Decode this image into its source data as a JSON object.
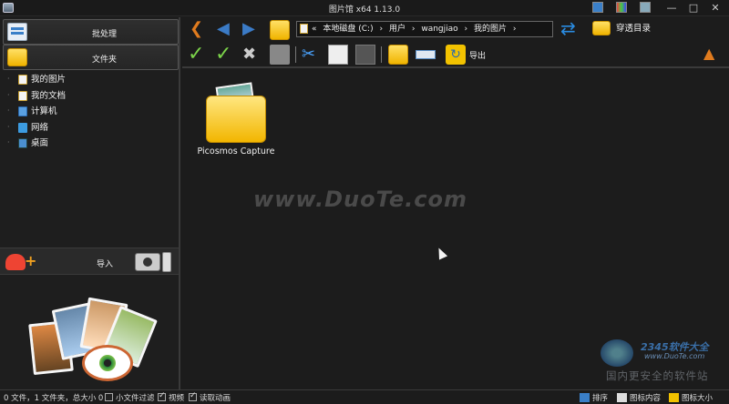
{
  "window": {
    "title": "图片馆 x64 1.13.0",
    "controls": [
      "—",
      "□",
      "✕"
    ]
  },
  "left_panel": {
    "batch_label": "批处理",
    "folder_label": "文件夹",
    "tree": [
      {
        "label": "我的图片",
        "icon": "pictures-icon"
      },
      {
        "label": "我的文档",
        "icon": "documents-icon"
      },
      {
        "label": "计算机",
        "icon": "computer-icon"
      },
      {
        "label": "网络",
        "icon": "network-icon"
      },
      {
        "label": "桌面",
        "icon": "desktop-icon"
      }
    ],
    "import_label": "导入"
  },
  "toolbar": {
    "path": [
      "«",
      "本地磁盘 (C:)",
      "›",
      "用户",
      "›",
      "wangjiao",
      "›",
      "我的图片",
      "›"
    ],
    "see_through_label": "穿透目录",
    "export_label": "导出"
  },
  "content": {
    "folders": [
      {
        "name": "Picosmos Capture"
      }
    ],
    "watermark": "www.DuoTe.com",
    "corner_watermark": {
      "line1": "2345软件大全",
      "line2": "www.DuoTe.com",
      "line3": "国内更安全的软件站"
    }
  },
  "status": {
    "summary": "0 文件，1 文件夹，总大小 0",
    "small_file_filter_label": "小文件过滤",
    "small_file_filter_checked": false,
    "preview_label": "视频",
    "preview_checked": true,
    "animation_label": "读取动画",
    "animation_checked": true,
    "sort_label": "排序",
    "icon_content_label": "图标内容",
    "icon_size_label": "图标大小"
  },
  "colors": {
    "background": "#1c1c1c",
    "accent_orange": "#e07b1e",
    "accent_blue": "#2a8be0",
    "folder_yellow": "#f2b600"
  }
}
